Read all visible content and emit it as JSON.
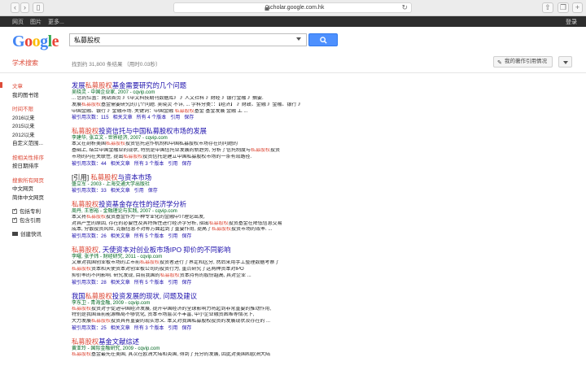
{
  "browser": {
    "url": "scholar.google.com.hk"
  },
  "gbar": {
    "items": [
      "网页",
      "图片",
      "更多..."
    ],
    "signin": "登录"
  },
  "logo": [
    "G",
    "o",
    "o",
    "g",
    "l",
    "e"
  ],
  "search": {
    "query": "私募股权"
  },
  "header": {
    "title": "学术搜索",
    "result_count": "找到约 31,800 条结果 （用时0.03秒）",
    "my_citations": "我的著作引用情况"
  },
  "sidebar": {
    "groups": [
      [
        "文章",
        "我的图书馆"
      ],
      [
        "时间不限",
        "2016以来",
        "2015以来",
        "2012以来",
        "自定义范围..."
      ],
      [
        "按相关性排序",
        "按日期排序"
      ],
      [
        "搜索所有网页",
        "中文网页",
        "简体中文网页"
      ],
      [
        "包括专利",
        "包含引用"
      ],
      [
        "创建快讯"
      ]
    ]
  },
  "results": [
    {
      "title_pre": "发展",
      "title_hl": "私募股权",
      "title_post": "基金需要研究的几个问题",
      "meta": "吴晓灵 - 中国企业家, 2007 - cqvip.com",
      "snippet": [
        [
          "",
          "",
          "... 您的位置：网站首页 》《中文科技期刊数据库》 》人文社科 》财经 》银行金融 》摘要."
        ],
        [
          "发展",
          "私募股权",
          "基金需要研究的几个问题. 吴晓灵 不详, ... 学科分类：：【经济】 》财政、金融 》金融、银行 》"
        ],
        [
          "中国金融、银行 》金融市场. 关键词：中国金融 ",
          "私募股权",
          "基金 基金发展 金融 工 ... "
        ]
      ],
      "links": [
        "被引用次数：115",
        "相关文章",
        "所有 4 个版本",
        "引用",
        "保存"
      ]
    },
    {
      "title_pre": "",
      "title_hl": "私募股权",
      "title_post": "投资信托与中国私募股权市场的发展",
      "meta": "李建华, 张立文 - 世界经济, 2007 - cqvip.com",
      "snippet": [
        [
          "本文在剖析美国",
          "私募股权",
          "投资信托运作机制和中国私募股权市场存在的问题的"
        ],
        [
          "基础上, 结合中国金融业的现状, 特别是中国信托业发展的新趋势, 分析了信托制度与",
          "私募股权",
          "投资"
        ],
        [
          "市场的内在关联性, 提出",
          "私募股权",
          "投资信托是建立中国私募股权市场的一条有效路径."
        ]
      ],
      "links": [
        "被引用次数：44",
        "相关文章",
        "所有 3 个版本",
        "引用",
        "保存"
      ]
    },
    {
      "tag": "[引用] ",
      "title_pre": "",
      "title_hl": "私募股权",
      "title_post": "与资本市场",
      "meta": "盛立军 - 2003 - 上海交通大学出版社",
      "snippet": [],
      "links": [
        "被引用次数：33",
        "相关文章",
        "引用",
        "保存"
      ]
    },
    {
      "title_pre": "",
      "title_hl": "私募股权",
      "title_post": "投资基金存在性的经济学分析",
      "meta": "周丹, 王恩裕 - 金融理论与实践, 2007 - cqvip.com",
      "snippet": [
        [
          "本文将",
          "私募股权",
          "投资基金作为一种专业化的金融中介理论出发,"
        ],
        [
          "对其产生的原因, 存在的必要性及其特殊性进行经济学分析, 指出",
          "私募股权",
          "投资基金在降低信息交易"
        ],
        [
          "成本, 分散投资风险, 克服信息不对称方面起到了重要作用, 提高了",
          "私募股权",
          "投资市场的效率. ..."
        ]
      ],
      "links": [
        "被引用次数：26",
        "相关文章",
        "所有 5 个版本",
        "引用",
        "保存"
      ]
    },
    {
      "title_pre": "",
      "title_hl": "私募股权",
      "title_post": ", 天使资本对创业板市场IPO 抑价的不同影响",
      "meta": "李曜, 张子炜 - 财经研究, 2011 - cqvip.com",
      "snippet": [
        [
          "文章对我国创业板市场的上市前",
          "私募股权",
          "投资者进行了界定和区分, 然后采用手工整理数据考察了"
        ],
        [
          "",
          "私募股权",
          "资本和天使资本对创业板公司的投资行为, 重点研究了这两种资本对IPO"
        ],
        [
          "抑价率的不同影响. 研究发现, 目前我国的",
          "私募股权",
          "资本持有的股份越高, 其对企业 ..."
        ]
      ],
      "links": [
        "被引用次数：28",
        "相关文章",
        "所有 5 个版本",
        "引用",
        "保存"
      ]
    },
    {
      "title_pre": "我国",
      "title_hl": "私募股权",
      "title_post": "投资发展的现状, 问题及建议",
      "meta": "李东卫 - 青海金融, 2009 - cqvip.com",
      "snippet": [
        [
          "",
          "私募股权",
          "投资对于促进中国经济发展, 提升中国经济的全球影响力将起到非常重要的推动作用,"
        ],
        [
          "特别是我国当前能源格局不够优化, 资本市场层次不丰富, 中小企业融资困难等情况下,"
        ],
        [
          "大力发展",
          "私募股权",
          "投资具有重要的现实意义. 本文对我国私募股权投资的发展现状及存在的 ..."
        ]
      ],
      "links": [
        "被引用次数：25",
        "相关文章",
        "所有 3 个版本",
        "引用",
        "保存"
      ]
    },
    {
      "title_pre": "",
      "title_hl": "私募股权",
      "title_post": "基金文献综述",
      "meta": "黄亚玲 - 国际金融研究, 2009 - cqvip.com",
      "snippet": [
        [
          "",
          "私募股权",
          "基金最先在美国, 其次在欧洲大陆和英国, 得到了充分的发展, 因此对美国和欧洲大陆"
        ]
      ],
      "links": []
    }
  ]
}
